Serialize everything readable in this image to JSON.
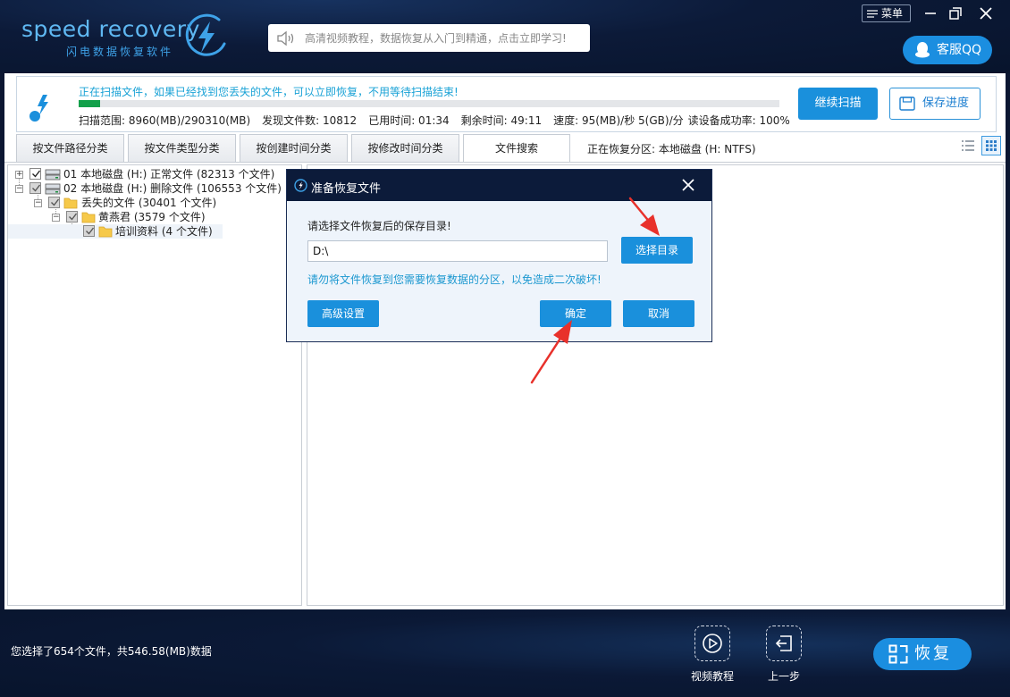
{
  "app": {
    "logo_text": "speed recovery",
    "logo_subtitle": "闪电数据恢复软件",
    "notice": "高清视频教程，数据恢复从入门到精通，点击立即学习!",
    "menu_label": "菜单",
    "qq_label": "客服QQ"
  },
  "scan": {
    "status_text": "正在扫描文件，如果已经找到您丢失的文件，可以立即恢复，不用等待扫描结束!",
    "progress_percent": 3,
    "stats": [
      "扫描范围: 8960(MB)/290310(MB)",
      "发现文件数: 10812",
      "已用时间: 01:34",
      "剩余时间: 49:11",
      "速度: 95(MB)/秒  5(GB)/分",
      "读设备成功率: 100%"
    ],
    "continue_label": "继续扫描",
    "save_label": "保存进度"
  },
  "tabs": [
    {
      "label": "按文件路径分类"
    },
    {
      "label": "按文件类型分类"
    },
    {
      "label": "按创建时间分类"
    },
    {
      "label": "按修改时间分类"
    },
    {
      "label": "文件搜索"
    }
  ],
  "partition_info": "正在恢复分区: 本地磁盘 (H: NTFS)",
  "tree": [
    {
      "label": "01 本地磁盘 (H:) 正常文件 (82313 个文件)"
    },
    {
      "label": "02 本地磁盘 (H:) 删除文件 (106553 个文件)"
    },
    {
      "label": "丢失的文件    (30401 个文件)"
    },
    {
      "label": "黄燕君    (3579 个文件)"
    },
    {
      "label": "培训资料    (4 个文件)"
    }
  ],
  "footer": {
    "selection_info": "您选择了654个文件，共546.58(MB)数据",
    "video_label": "视频教程",
    "back_label": "上一步",
    "restore_label": "恢复"
  },
  "dialog": {
    "title": "准备恢复文件",
    "prompt": "请选择文件恢复后的保存目录!",
    "path_value": "D:\\",
    "choose_dir_label": "选择目录",
    "warning": "请勿将文件恢复到您需要恢复数据的分区，以免造成二次破坏!",
    "advanced_label": "高级设置",
    "ok_label": "确定",
    "cancel_label": "取消"
  },
  "colors": {
    "accent": "#1a90dc",
    "header_bg": "#0c1a38",
    "status_text": "#19a2d6",
    "progress": "#12a04a",
    "annotation_arrow": "#e8312b"
  }
}
